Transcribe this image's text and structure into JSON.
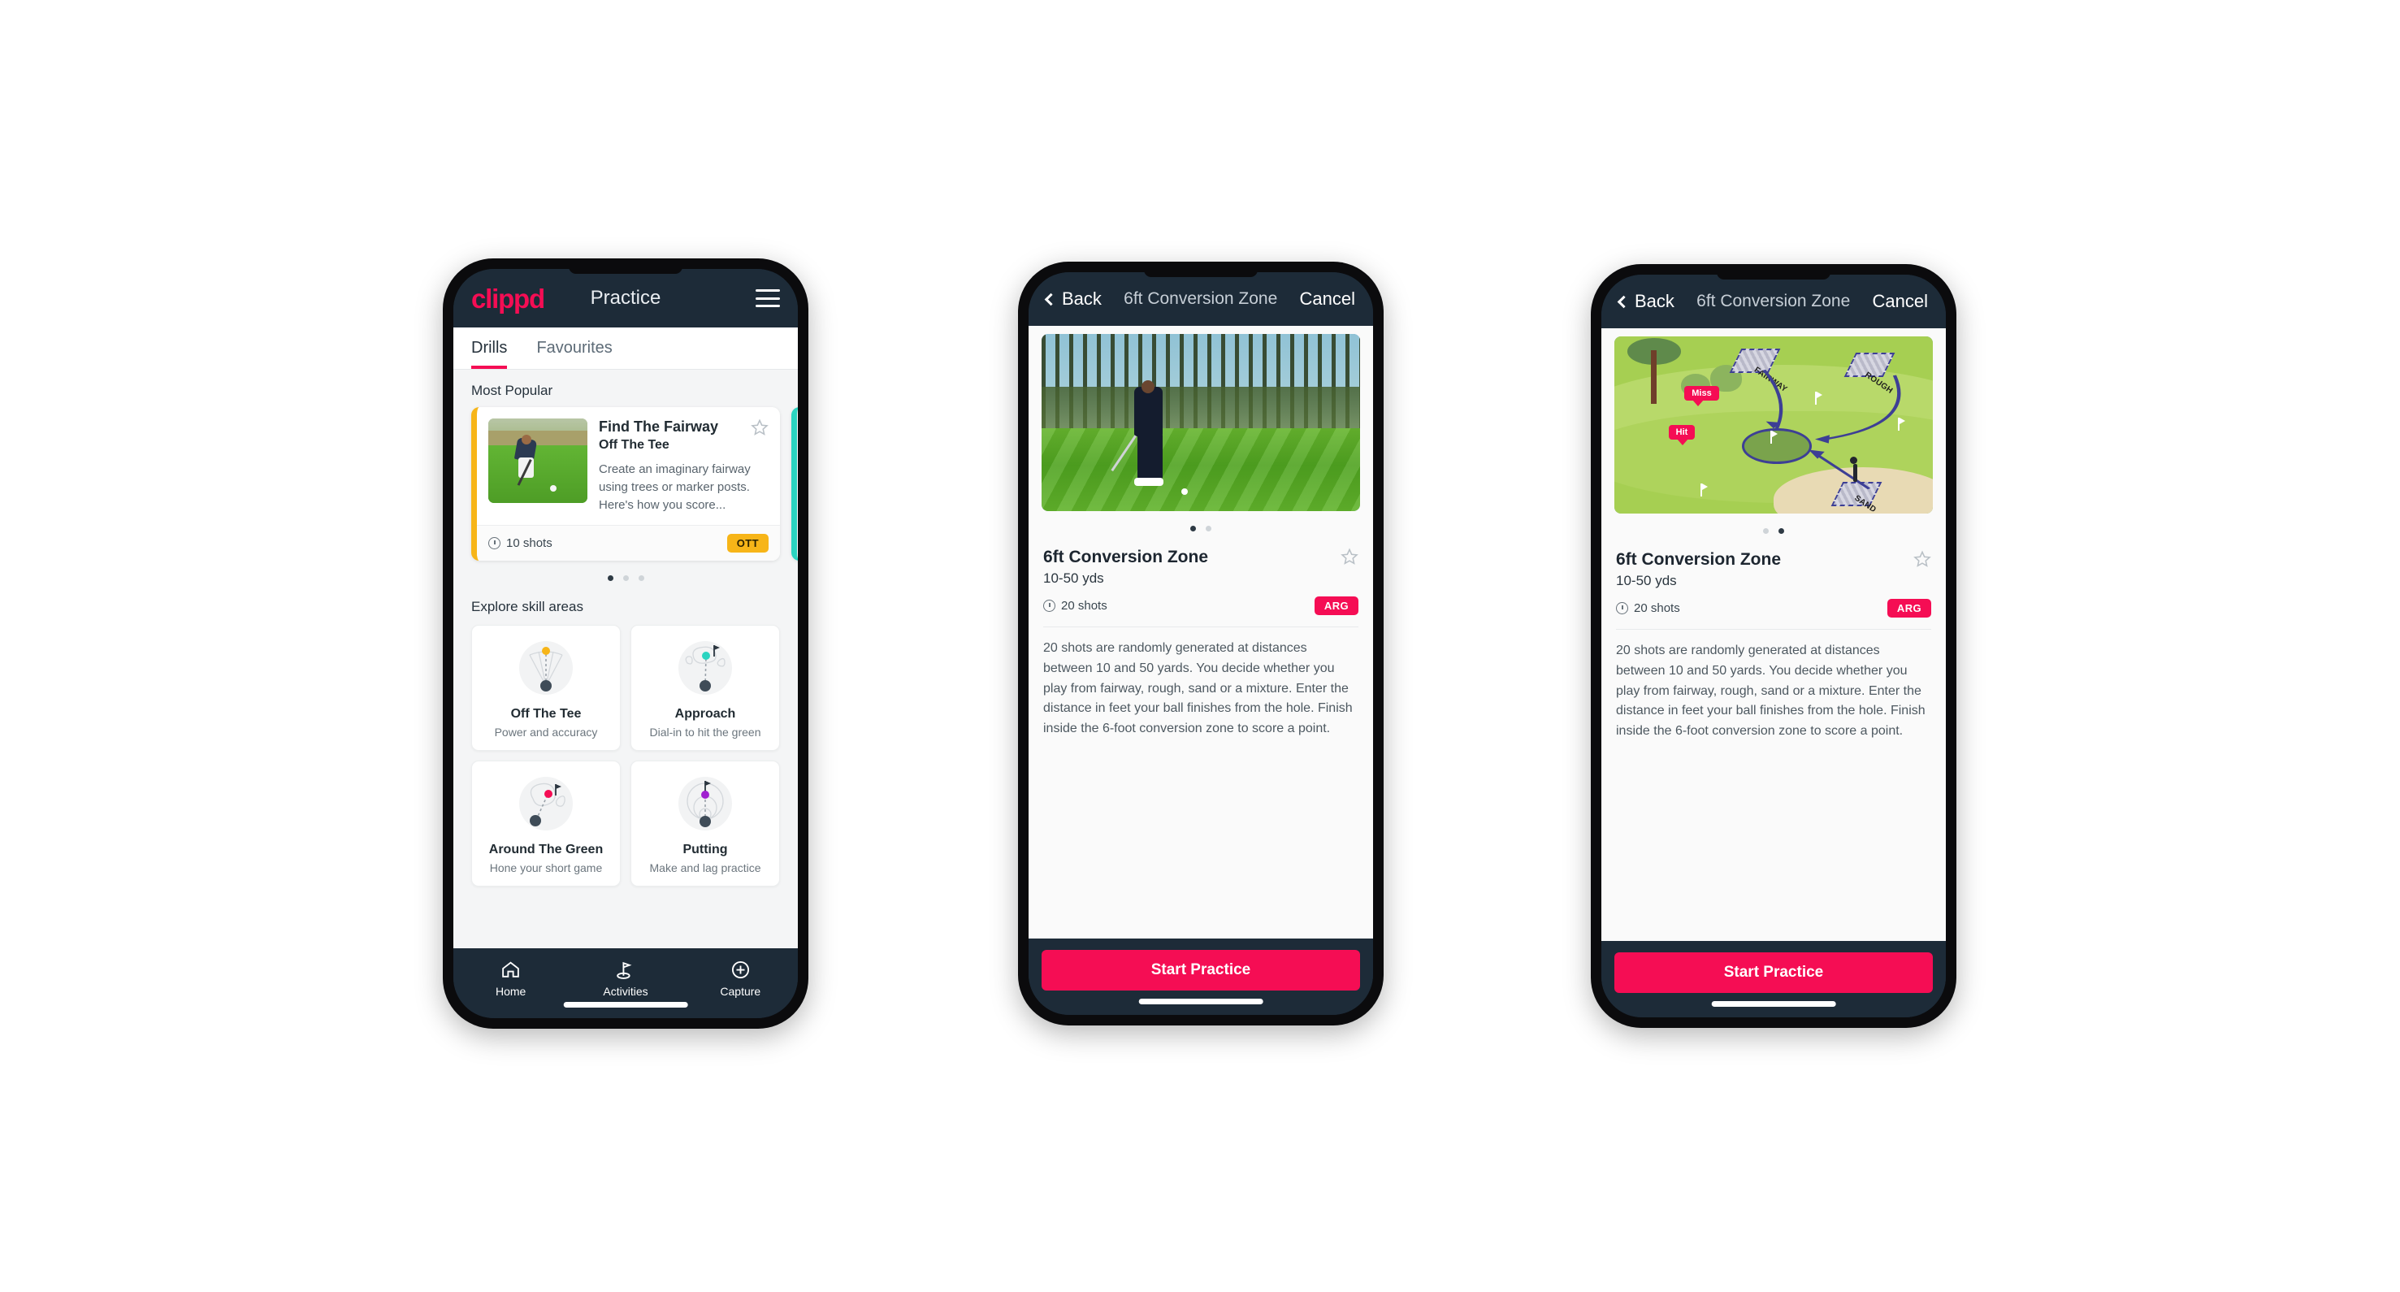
{
  "brand": "clippd",
  "phone1": {
    "appbar": {
      "title": "Practice",
      "menu_icon": "hamburger-icon"
    },
    "tabs": [
      {
        "label": "Drills",
        "active": true
      },
      {
        "label": "Favourites",
        "active": false
      }
    ],
    "most_popular_label": "Most Popular",
    "drill_card": {
      "title": "Find The Fairway",
      "subtitle": "Off The Tee",
      "description": "Create an imaginary fairway using trees or marker posts. Here's how you score...",
      "shots": "10 shots",
      "badge": "OTT",
      "badge_color": "#f7b518",
      "accent_color": "#f7b518",
      "next_accent_color": "#2ad4c0",
      "favourite_icon": "star-outline-icon"
    },
    "carousel_dots": 3,
    "carousel_active": 0,
    "skill_label": "Explore skill areas",
    "skills": [
      {
        "name": "Off The Tee",
        "desc": "Power and accuracy",
        "icon": "tee-fan-icon",
        "dot_color": "#f7b518"
      },
      {
        "name": "Approach",
        "desc": "Dial-in to hit the green",
        "icon": "approach-green-icon",
        "dot_color": "#2ad4c0"
      },
      {
        "name": "Around The Green",
        "desc": "Hone your short game",
        "icon": "chip-green-icon",
        "dot_color": "#f50d54"
      },
      {
        "name": "Putting",
        "desc": "Make and lag practice",
        "icon": "putting-rings-icon",
        "dot_color": "#a020d0"
      }
    ],
    "tabbar": [
      {
        "label": "Home",
        "icon": "home-icon",
        "active": false
      },
      {
        "label": "Activities",
        "icon": "golf-flag-icon",
        "active": true
      },
      {
        "label": "Capture",
        "icon": "plus-circle-icon",
        "active": false
      }
    ]
  },
  "phone2": {
    "nav": {
      "back": "Back",
      "title": "6ft Conversion Zone",
      "cancel": "Cancel",
      "back_icon": "chevron-left-icon"
    },
    "media_kind": "golfer-video-still",
    "carousel_dots": 2,
    "carousel_active": 0,
    "detail": {
      "title": "6ft Conversion Zone",
      "yards": "10-50 yds",
      "shots": "20 shots",
      "badge": "ARG",
      "badge_color": "#f50d54",
      "favourite_icon": "star-outline-icon",
      "description": "20 shots are randomly generated at distances between 10 and 50 yards. You decide whether you play from fairway, rough, sand or a mixture. Enter the distance in feet your ball finishes from the hole. Finish inside the 6-foot conversion zone to score a point."
    },
    "cta": "Start Practice"
  },
  "phone3": {
    "nav": {
      "back": "Back",
      "title": "6ft Conversion Zone",
      "cancel": "Cancel",
      "back_icon": "chevron-left-icon"
    },
    "media_kind": "golf-course-diagram",
    "map_labels": {
      "fairway": "FAIRWAY",
      "rough": "ROUGH",
      "sand": "SAND",
      "miss": "Miss",
      "hit": "Hit"
    },
    "carousel_dots": 2,
    "carousel_active": 1,
    "detail": {
      "title": "6ft Conversion Zone",
      "yards": "10-50 yds",
      "shots": "20 shots",
      "badge": "ARG",
      "badge_color": "#f50d54",
      "favourite_icon": "star-outline-icon",
      "description": "20 shots are randomly generated at distances between 10 and 50 yards. You decide whether you play from fairway, rough, sand or a mixture. Enter the distance in feet your ball finishes from the hole. Finish inside the 6-foot conversion zone to score a point."
    },
    "cta": "Start Practice"
  }
}
